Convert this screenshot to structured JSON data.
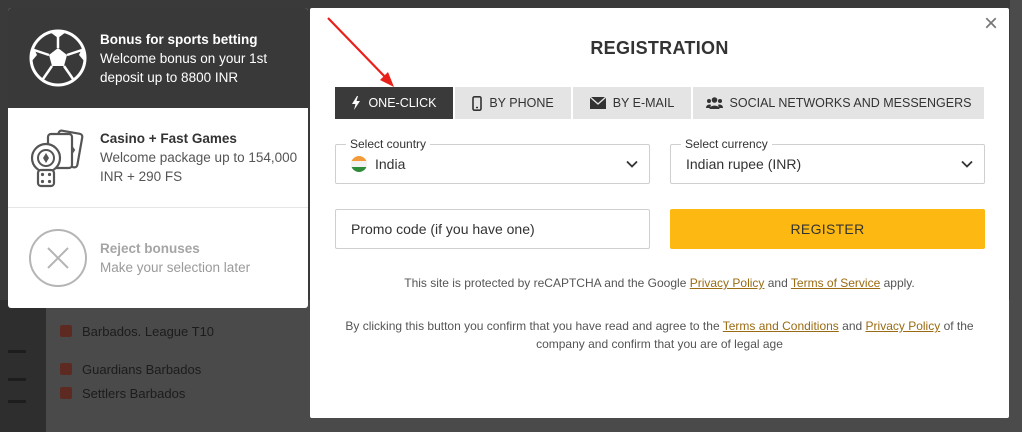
{
  "background": {
    "rows": [
      {
        "label": "Barbados. League T10"
      },
      {
        "label": "Guardians Barbados"
      },
      {
        "label": "Settlers Barbados"
      }
    ]
  },
  "bonus_panel": {
    "items": [
      {
        "title": "Bonus for sports betting",
        "description": "Welcome bonus on your 1st deposit up to 8800 INR",
        "icon": "soccer-ball-icon"
      },
      {
        "title": "Casino + Fast Games",
        "description": "Welcome package up to 154,000 INR + 290 FS",
        "icon": "casino-chips-cards-dice-icon"
      },
      {
        "title": "Reject bonuses",
        "description": "Make your selection later",
        "icon": "reject-x-icon"
      }
    ]
  },
  "modal": {
    "title": "REGISTRATION",
    "close_label": "×",
    "tabs": [
      {
        "label": "ONE-CLICK",
        "icon": "lightning-icon"
      },
      {
        "label": "BY PHONE",
        "icon": "phone-icon"
      },
      {
        "label": "BY E-MAIL",
        "icon": "envelope-icon"
      },
      {
        "label": "SOCIAL NETWORKS AND MESSENGERS",
        "icon": "users-icon"
      }
    ],
    "country": {
      "label": "Select country",
      "value": "India"
    },
    "currency": {
      "label": "Select currency",
      "value": "Indian rupee (INR)"
    },
    "promo": {
      "placeholder": "Promo code (if you have one)"
    },
    "register_label": "REGISTER",
    "recaptcha": {
      "prefix": "This site is protected by reCAPTCHA and the Google",
      "privacy_link": "Privacy Policy",
      "and": "and",
      "terms_link": "Terms of Service",
      "suffix": "apply."
    },
    "consent": {
      "prefix": "By clicking this button you confirm that you have read and agree to the",
      "terms_link": "Terms and Conditions",
      "and": "and",
      "privacy_link": "Privacy Policy",
      "suffix": "of the company and confirm that you are of legal age"
    }
  },
  "colors": {
    "accent_yellow": "#fdb912",
    "active_tab": "#3a3a3a",
    "link": "#9a6b12",
    "annotation_arrow": "#e8201a"
  }
}
